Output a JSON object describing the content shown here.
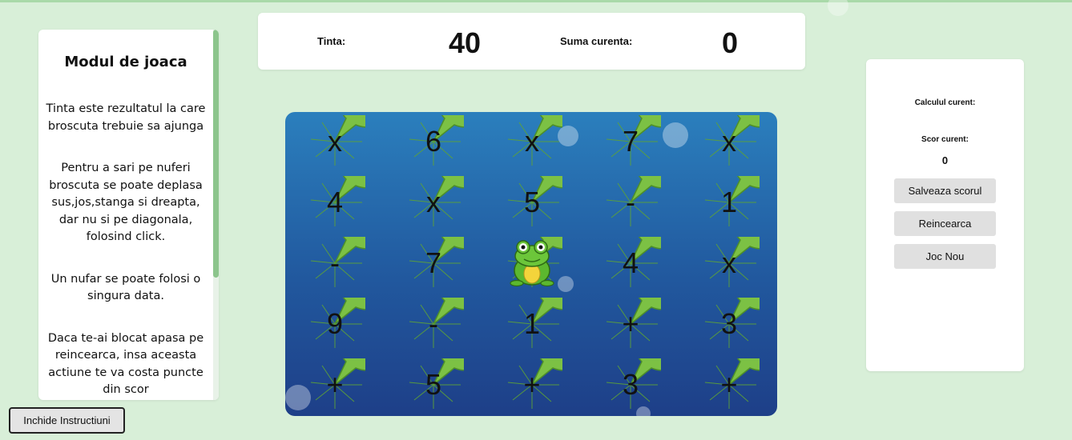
{
  "instructions": {
    "title": "Modul de joaca",
    "paragraphs": [
      "Tinta este rezultatul la care broscuta trebuie sa ajunga",
      "Pentru a sari pe nuferi broscuta se poate deplasa sus,jos,stanga si dreapta, dar nu si pe diagonala, folosind click.",
      "Un nufar se poate folosi o singura data.",
      "Daca te-ai blocat apasa pe reincearca, insa aceasta actiune te va costa puncte din scor"
    ],
    "close_button": "Inchide Instructiuni"
  },
  "header": {
    "target_label": "Tinta:",
    "target_value": "40",
    "sum_label": "Suma curenta:",
    "sum_value": "0"
  },
  "board": {
    "rows": [
      [
        "x",
        "6",
        "x",
        "7",
        "x"
      ],
      [
        "4",
        "x",
        "5",
        "-",
        "1"
      ],
      [
        "-",
        "7",
        "frog",
        "4",
        "x"
      ],
      [
        "9",
        "-",
        "1",
        "+",
        "3"
      ],
      [
        "+",
        "5",
        "+",
        "3",
        "+"
      ]
    ],
    "frog_position": [
      2,
      2
    ]
  },
  "score_panel": {
    "current_calc_label": "Calculul curent:",
    "current_calc_value": "",
    "current_score_label": "Scor curent:",
    "current_score_value": "0",
    "save_button": "Salveaza scorul",
    "retry_button": "Reincearca",
    "new_game_button": "Joc Nou"
  },
  "colors": {
    "background": "#d8efd8",
    "lily_pad": "#7cc144",
    "board_top": "#2b7fbd",
    "board_bottom": "#1e3f88"
  }
}
